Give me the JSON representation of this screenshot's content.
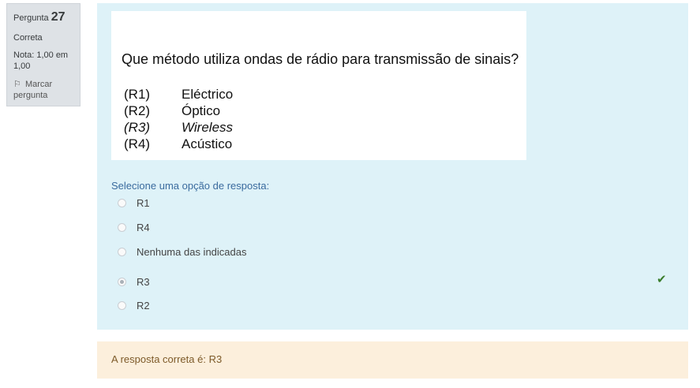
{
  "info": {
    "question_label": "Pergunta",
    "question_number": "27",
    "state": "Correta",
    "grade": "Nota: 1,00 em 1,00",
    "flag_label": "Marcar pergunta"
  },
  "question": {
    "text": "Que método utiliza ondas de rádio para transmissão de sinais?",
    "options": [
      {
        "code": "(R1)",
        "label": "Eléctrico"
      },
      {
        "code": "(R2)",
        "label": "Óptico"
      },
      {
        "code": "(R3)",
        "label": "Wireless"
      },
      {
        "code": "(R4)",
        "label": "Acústico"
      }
    ]
  },
  "answer": {
    "prompt": "Selecione uma opção de resposta:",
    "choices": [
      {
        "label": "R1",
        "checked": false
      },
      {
        "label": "R4",
        "checked": false
      },
      {
        "label": "Nenhuma das indicadas",
        "checked": false
      },
      {
        "label": "R3",
        "checked": true
      },
      {
        "label": "R2",
        "checked": false
      }
    ],
    "correct_mark": "✔"
  },
  "feedback": {
    "right_answer": "A resposta correta é: R3"
  },
  "colors": {
    "content_bg": "#def2f8",
    "feedback_bg": "#fcefdc",
    "check": "#3a7d2c"
  }
}
